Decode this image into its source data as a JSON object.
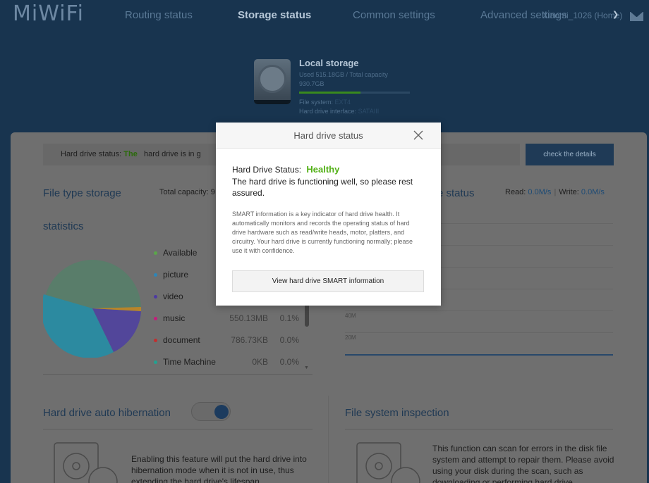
{
  "header": {
    "logo": "MiWiFi",
    "nav": [
      "Routing status",
      "Storage status",
      "Common settings",
      "Advanced settings"
    ],
    "active_nav": "Storage status",
    "router_name": "Xiaomi_1026 (Home)"
  },
  "local_storage": {
    "title": "Local storage",
    "used_text": "Used 515.18GB / Total capacity 930.7GB",
    "used_fraction": 0.553,
    "file_system_label": "File system:",
    "file_system_value": "EXT4",
    "interface_label": "Hard drive interface:",
    "interface_value": "SATAIII"
  },
  "status_strip": {
    "label": "Hard drive status:",
    "value": "The",
    "rest": "hard drive is in g",
    "button": "check the details"
  },
  "file_type": {
    "title_line1": "File type storage",
    "title_line2": "statistics",
    "total_capacity": "Total capacity: 9"
  },
  "legend": [
    {
      "name": "Available",
      "size": "",
      "pct": "",
      "color": "#5aa64a"
    },
    {
      "name": "picture",
      "size": "",
      "pct": "",
      "color": "#2d86b8"
    },
    {
      "name": "video",
      "size": "",
      "pct": "",
      "color": "#4d3aa2"
    },
    {
      "name": "music",
      "size": "550.13MB",
      "pct": "0.1%",
      "color": "#c41d7c"
    },
    {
      "name": "document",
      "size": "786.73KB",
      "pct": "0.0%",
      "color": "#c22f2f"
    },
    {
      "name": "Time Machine",
      "size": "0KB",
      "pct": "0.0%",
      "color": "#23a191"
    }
  ],
  "disk_status": {
    "title": "e status",
    "read_label": "Read:",
    "read_value": "0.0M/s",
    "write_label": "Write:",
    "write_value": "0.0M/s",
    "axis": [
      "40M",
      "20M"
    ]
  },
  "hibernation": {
    "title": "Hard drive auto hibernation",
    "enabled": true,
    "desc": "Enabling this feature will put the hard drive into hibernation mode when it is not in use, thus extending the hard drive's lifespan."
  },
  "fs_inspection": {
    "title": "File system inspection",
    "desc": "This function can scan for errors in the disk file system and attempt to repair them. Please avoid using your disk during the scan, such as downloading or performing hard drive"
  },
  "modal": {
    "title": "Hard drive status",
    "status_label": "Hard Drive Status:",
    "status_value": "Healthy",
    "message": "The hard drive is functioning well, so please rest assured.",
    "smart_info": "SMART information is a key indicator of hard drive health. It automatically monitors and records the operating status of hard drive hardware such as read/write heads, motor, platters, and circuitry. Your hard drive is currently functioning normally; please use it with confidence.",
    "button": "View hard drive SMART information"
  },
  "colors": {
    "healthy": "#52b015",
    "brand_blue": "#1f3a56"
  }
}
